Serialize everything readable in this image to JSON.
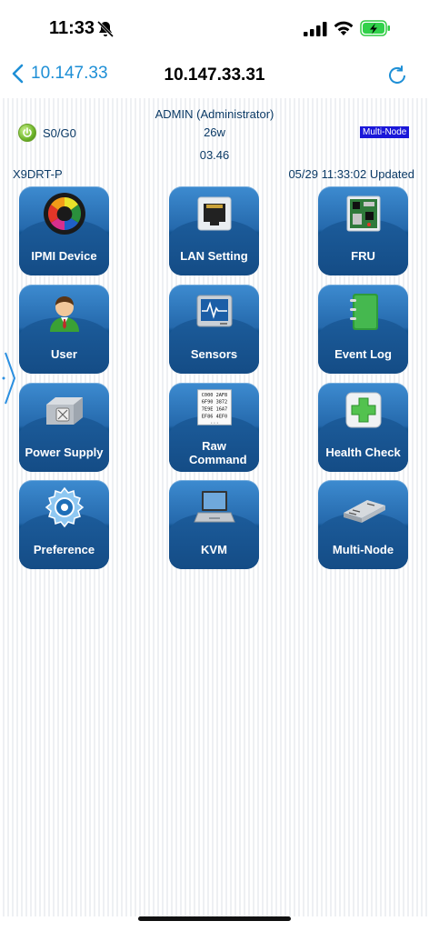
{
  "status_bar": {
    "time": "11:33",
    "icons": [
      "bell-off-icon",
      "signal-icon",
      "wifi-icon",
      "battery-charging-icon"
    ]
  },
  "nav": {
    "back_label": "10.147.33",
    "title": "10.147.33.31"
  },
  "info": {
    "admin": "ADMIN (Administrator)",
    "power_state": "S0/G0",
    "watts": "26w",
    "multinode_tag": "Multi-Node",
    "version": "03.46",
    "model": "X9DRT-P",
    "updated": "05/29 11:33:02 Updated"
  },
  "tiles": [
    {
      "label": "IPMI Device",
      "icon": "ipmi-device-icon"
    },
    {
      "label": "LAN Setting",
      "icon": "ethernet-port-icon"
    },
    {
      "label": "FRU",
      "icon": "circuit-board-icon"
    },
    {
      "label": "User",
      "icon": "user-icon"
    },
    {
      "label": "Sensors",
      "icon": "monitor-waveform-icon"
    },
    {
      "label": "Event Log",
      "icon": "notebook-icon"
    },
    {
      "label": "Power Supply",
      "icon": "power-supply-icon"
    },
    {
      "label": "Raw Command",
      "icon": "hex-code-icon",
      "hex": [
        "C000 2AF8",
        "6F90 3872",
        "7E9E 16A7",
        "EF86 4EF0",
        "..."
      ]
    },
    {
      "label": "Health Check",
      "icon": "medical-cross-icon"
    },
    {
      "label": "Preference",
      "icon": "gear-icon"
    },
    {
      "label": "KVM",
      "icon": "laptop-icon"
    },
    {
      "label": "Multi-Node",
      "icon": "server-blade-icon"
    }
  ]
}
